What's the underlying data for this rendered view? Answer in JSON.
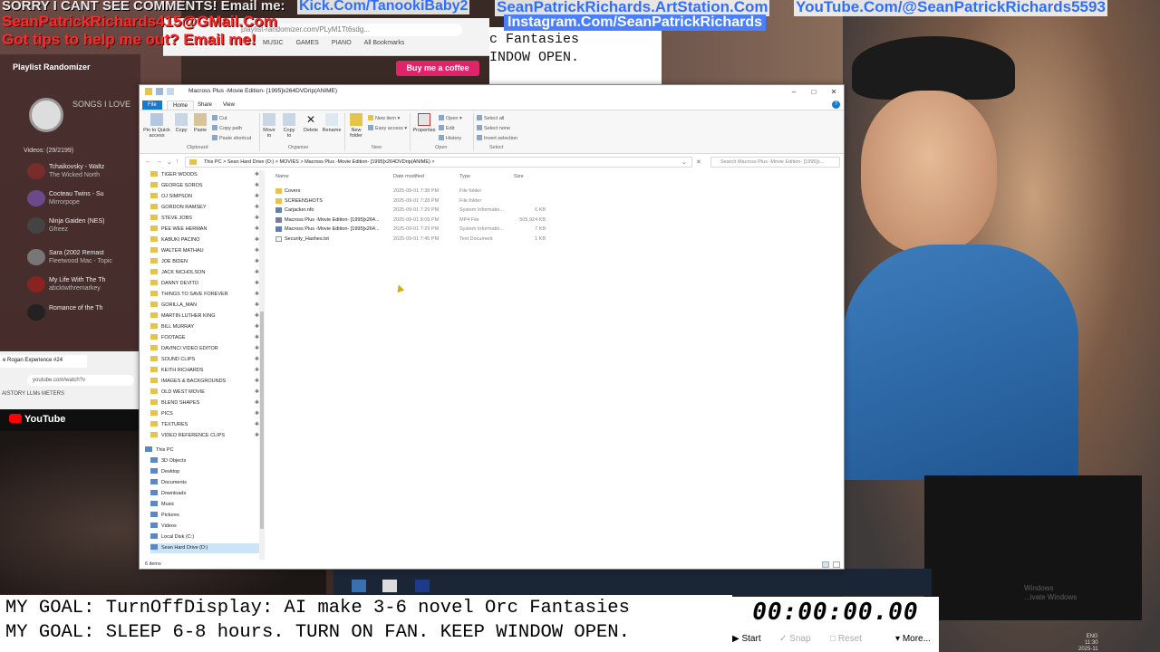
{
  "banners": {
    "sorry": "SORRY I CANT SEE COMMENTS! Email me:",
    "email": "SeanPatrickRichards415@GMail.Com",
    "tips": "Got tips to help me out? Email me!",
    "kick": "Kick.Com/TanookiBaby2",
    "artstation": "SeanPatrickRichards.ArtStation.Com",
    "youtube": "YouTube.Com/@SeanPatrickRichards5593",
    "instagram": "Instagram.Com/SeanPatrickRichards"
  },
  "browser_back": {
    "url": "playlist-randomizer.com/PLyM1Tt6sdg...",
    "bookmarks": [
      "MUSIC",
      "GAMES",
      "PIANO",
      "All Bookmarks"
    ],
    "editor_line1": "c Fantasies",
    "editor_line2": "INDOW OPEN.",
    "coffee": "Buy me a coffee"
  },
  "playlist": {
    "title": "Playlist Randomizer",
    "songs_label": "SONGS I LOVE",
    "count": "Videos: (29/2199)",
    "items": [
      {
        "title": "Tchaikovsky - Waltz",
        "sub": "The Wicked North"
      },
      {
        "title": "Cocteau Twins - Su",
        "sub": "Mirrorpope"
      },
      {
        "title": "Ninja Gaiden (NES)",
        "sub": "Gfreez"
      },
      {
        "title": "Sara (2002 Remast",
        "sub": "Fleetwood Mac - Topic"
      },
      {
        "title": "My Life With The Th",
        "sub": "abcktwthremarkey"
      },
      {
        "title": "Romance of the Th",
        "sub": ""
      }
    ]
  },
  "browser2": {
    "tab": "e Rogan Experience #24",
    "url": "youtube.com/watch?v",
    "bookmarks": "AISTORY   LLMs   METERS",
    "youtube": "YouTube"
  },
  "explorer": {
    "title": "Macross Plus -Movie Edition- [1995]x264DVDrip(ANIME)",
    "menu": {
      "file": "File",
      "home": "Home",
      "share": "Share",
      "view": "View"
    },
    "ribbon": {
      "pin": "Pin to Quick access",
      "copy": "Copy",
      "paste": "Paste",
      "cut": "Cut",
      "copy_path": "Copy path",
      "paste_shortcut": "Paste shortcut",
      "move_to": "Move to",
      "copy_to": "Copy to",
      "delete": "Delete",
      "rename": "Rename",
      "new_folder": "New folder",
      "new_item": "New item",
      "easy_access": "Easy access",
      "properties": "Properties",
      "open": "Open",
      "edit": "Edit",
      "history": "History",
      "select_all": "Select all",
      "select_none": "Select none",
      "invert_selection": "Invert selection",
      "groups": {
        "clipboard": "Clipboard",
        "organise": "Organise",
        "new": "New",
        "open": "Open",
        "select": "Select"
      }
    },
    "address": "This PC  >  Sean Hard Drive (D:)  >  MOVIES  >  Macross Plus -Movie Edition- [1995]x264DVDrip(ANIME)  >",
    "search_placeholder": "Search Macross Plus -Movie Edition- [1995]x...",
    "nav_folders": [
      "TIGER WOODS",
      "GEORGE SOROS",
      "OJ SIMPSON",
      "GORDON RAMSEY",
      "STEVE JOBS",
      "PEE WEE HERMAN",
      "KABUKI PACINO",
      "WALTER MATHAU",
      "JOE BIDEN",
      "JACK NICHOLSON",
      "DANNY DEVITO",
      "THINGS TO SAVE FOREVER",
      "GORILLA_MAN",
      "MARTIN LUTHER KING",
      "BILL MURRAY",
      "FOOTAGE",
      "DAVINCI VIDEO EDITOR",
      "SOUND CLIPS",
      "KEITH RICHARDS",
      "IMAGES & BACKGROUNDS",
      "OLD WEST MOVIE",
      "BLEND SHAPES",
      "PICS",
      "TEXTURES",
      "VIDEO REFERENCE CLIPS"
    ],
    "this_pc": "This PC",
    "pc_items": [
      "3D Objects",
      "Desktop",
      "Documents",
      "Downloads",
      "Music",
      "Pictures",
      "Videos",
      "Local Disk (C:)",
      "Sean Hard Drive (D:)"
    ],
    "columns": {
      "name": "Name",
      "date": "Date modified",
      "type": "Type",
      "size": "Size"
    },
    "files": [
      {
        "name": "Covers",
        "date": "2025-09-01 7:38 PM",
        "type": "File folder",
        "size": "",
        "kind": "folder"
      },
      {
        "name": "SCREENSHOTS",
        "date": "2025-09-01 7:28 PM",
        "type": "File folder",
        "size": "",
        "kind": "folder"
      },
      {
        "name": "Carjacker.nfo",
        "date": "2025-09-01 7:29 PM",
        "type": "System Informatio...",
        "size": "6 KB",
        "kind": "info"
      },
      {
        "name": "Macross Plus -Movie Edition- [1995]x264...",
        "date": "2025-09-01 8:09 PM",
        "type": "MP4 File",
        "size": "505,924 KB",
        "kind": "video"
      },
      {
        "name": "Macross Plus -Movie Edition- [1995]x264...",
        "date": "2025-09-01 7:29 PM",
        "type": "System Informatio...",
        "size": "7 KB",
        "kind": "info"
      },
      {
        "name": "Security_Hashes.txt",
        "date": "2025-09-01 7:45 PM",
        "type": "Text Document",
        "size": "1 KB",
        "kind": "text"
      }
    ],
    "status": "6 items"
  },
  "goals": {
    "line1": "MY GOAL: TurnOffDisplay: AI make 3-6 novel Orc Fantasies",
    "line2": "MY GOAL: SLEEP 6-8 hours. TURN ON FAN. KEEP WINDOW OPEN."
  },
  "timer": {
    "time": "00:00:00.00",
    "start": "Start",
    "snap": "Snap",
    "reset": "Reset",
    "more": "More..."
  },
  "tray": {
    "time": "11:30",
    "date": "2025-11",
    "lang": "ENG"
  },
  "watermark": {
    "line1": "Windows",
    "line2": "...ivate Windows"
  },
  "colors": {
    "banner_red": "#ff2a2a",
    "banner_blue": "#2f6fff",
    "explorer_accent": "#1979ca",
    "folder": "#e6c34a"
  }
}
